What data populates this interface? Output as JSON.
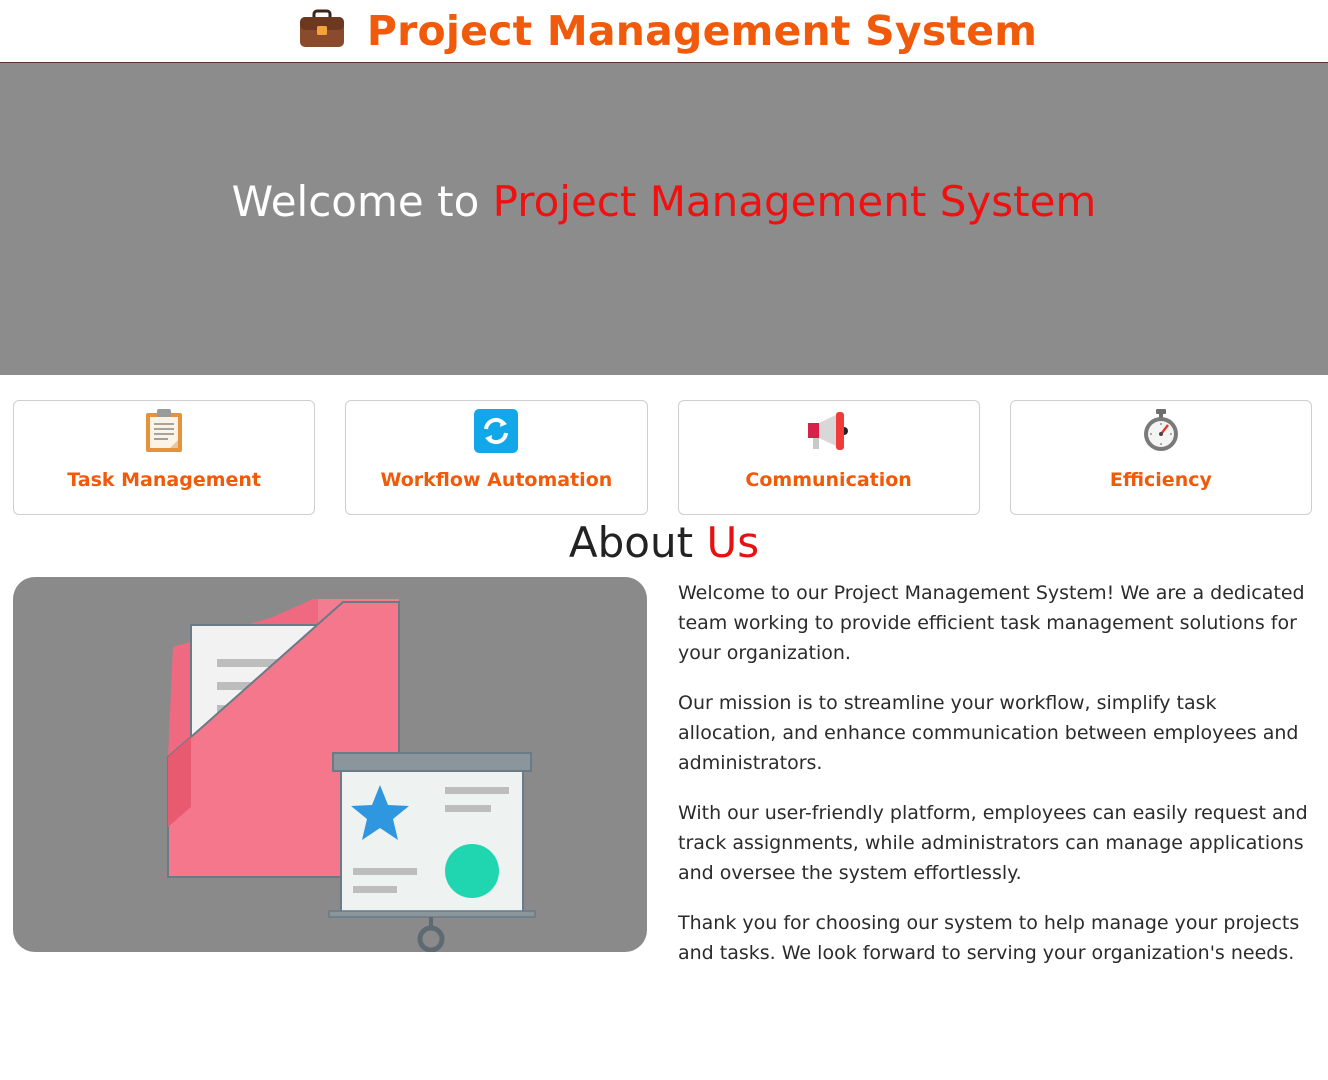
{
  "header": {
    "title": "Project Management System",
    "icon": "briefcase-icon"
  },
  "hero": {
    "prefix": "Welcome to",
    "highlight": "Project Management System"
  },
  "features": [
    {
      "label": "Task Management",
      "icon": "clipboard-icon"
    },
    {
      "label": "Workflow Automation",
      "icon": "sync-icon"
    },
    {
      "label": "Communication",
      "icon": "megaphone-icon"
    },
    {
      "label": "Efficiency",
      "icon": "stopwatch-icon"
    }
  ],
  "about": {
    "title_main": "About",
    "title_highlight": "Us",
    "image": "folder-presentation-illustration",
    "paragraphs": [
      "Welcome to our Project Management System! We are a dedicated team working to provide efficient task management solutions for your organization.",
      "Our mission is to streamline your workflow, simplify task allocation, and enhance communication between employees and administrators.",
      "With our user-friendly platform, employees can easily request and track assignments, while administrators can manage applications and oversee the system effortlessly.",
      "Thank you for choosing our system to help manage your projects and tasks. We look forward to serving your organization's needs."
    ]
  },
  "colors": {
    "brand_orange": "#f05a0a",
    "accent_red": "#f01010",
    "hero_bg": "#8c8c8c"
  }
}
